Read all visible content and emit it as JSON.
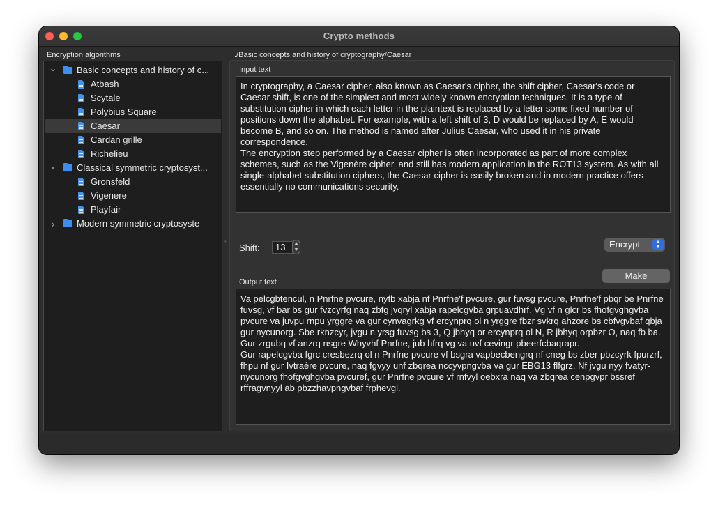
{
  "window": {
    "title": "Crypto methods"
  },
  "tree_panel": {
    "label": "Encryption algorithms",
    "items": [
      {
        "label": "Basic concepts and history of c...",
        "type": "folder",
        "expanded": true,
        "level": 0
      },
      {
        "label": "Atbash",
        "type": "doc",
        "level": 1
      },
      {
        "label": "Scytale",
        "type": "doc",
        "level": 1
      },
      {
        "label": "Polybius Square",
        "type": "doc",
        "level": 1
      },
      {
        "label": "Caesar",
        "type": "doc",
        "level": 1,
        "selected": true
      },
      {
        "label": "Cardan grille",
        "type": "doc",
        "level": 1
      },
      {
        "label": "Richelieu",
        "type": "doc",
        "level": 1
      },
      {
        "label": "Classical symmetric cryptosyst...",
        "type": "folder",
        "expanded": true,
        "level": 0
      },
      {
        "label": "Gronsfeld",
        "type": "doc",
        "level": 1
      },
      {
        "label": "Vigenere",
        "type": "doc",
        "level": 1
      },
      {
        "label": "Playfair",
        "type": "doc",
        "level": 1
      },
      {
        "label": "Modern symmetric cryptosyste",
        "type": "folder",
        "expanded": false,
        "level": 0
      }
    ]
  },
  "main": {
    "breadcrumb": "./Basic concepts and history of cryptography/Caesar",
    "input_label": "Input text",
    "input_text": "In cryptography, a Caesar cipher, also known as Caesar's cipher, the shift cipher, Caesar's code or Caesar shift, is one of the simplest and most widely known encryption techniques. It is a type of substitution cipher in which each letter in the plaintext is replaced by a letter some fixed number of positions down the alphabet. For example, with a left shift of 3, D would be replaced by A, E would become B, and so on. The method is named after Julius Caesar, who used it in his private correspondence.\nThe encryption step performed by a Caesar cipher is often incorporated as part of more complex schemes, such as the Vigenère cipher, and still has modern application in the ROT13 system. As with all single-alphabet substitution ciphers, the Caesar cipher is easily broken and in modern practice offers essentially no communications security.",
    "shift_label": "Shift:",
    "shift_value": "13",
    "mode_value": "Encrypt",
    "make_label": "Make",
    "output_label": "Output text",
    "output_text": "Va pelcgbtencul, n Pnrfne pvcure, nyfb xabja nf Pnrfne'f pvcure, gur fuvsg pvcure, Pnrfne'f pbqr be Pnrfne fuvsg, vf bar bs gur fvzcyrfg naq zbfg jvqryl xabja rapelcgvba grpuavdhrf. Vg vf n glcr bs fhofgvghgvba pvcure va juvpu rnpu yrggre va gur cynvagrkg vf ercynprq ol n yrggre fbzr svkrq ahzore bs cbfvgvbaf qbja gur nycunorg. Sbe rknzcyr, jvgu n yrsg fuvsg bs 3, Q jbhyq or ercynprq ol N, R jbhyq orpbzr O, naq fb ba. Gur zrgubq vf anzrq nsgre Whyvhf Pnrfne, jub hfrq vg va uvf cevingr pbeerfcbaqrapr.\nGur rapelcgvba fgrc cresbezrq ol n Pnrfne pvcure vf bsgra vapbecbengrq nf cneg bs zber pbzcyrk fpurzrf, fhpu nf gur Ivtraère pvcure, naq fgvyy unf zbqrea nccyvpngvba va gur EBG13 flfgrz. Nf jvgu nyy fvatyr-nycunorg fhofgvghgvba pvcuref, gur Pnrfne pvcure vf rnfvyl oebxra naq va zbqrea cenpgvpr bssref rffragvnyyl ab pbzzhavpngvbaf frphevgl."
  }
}
